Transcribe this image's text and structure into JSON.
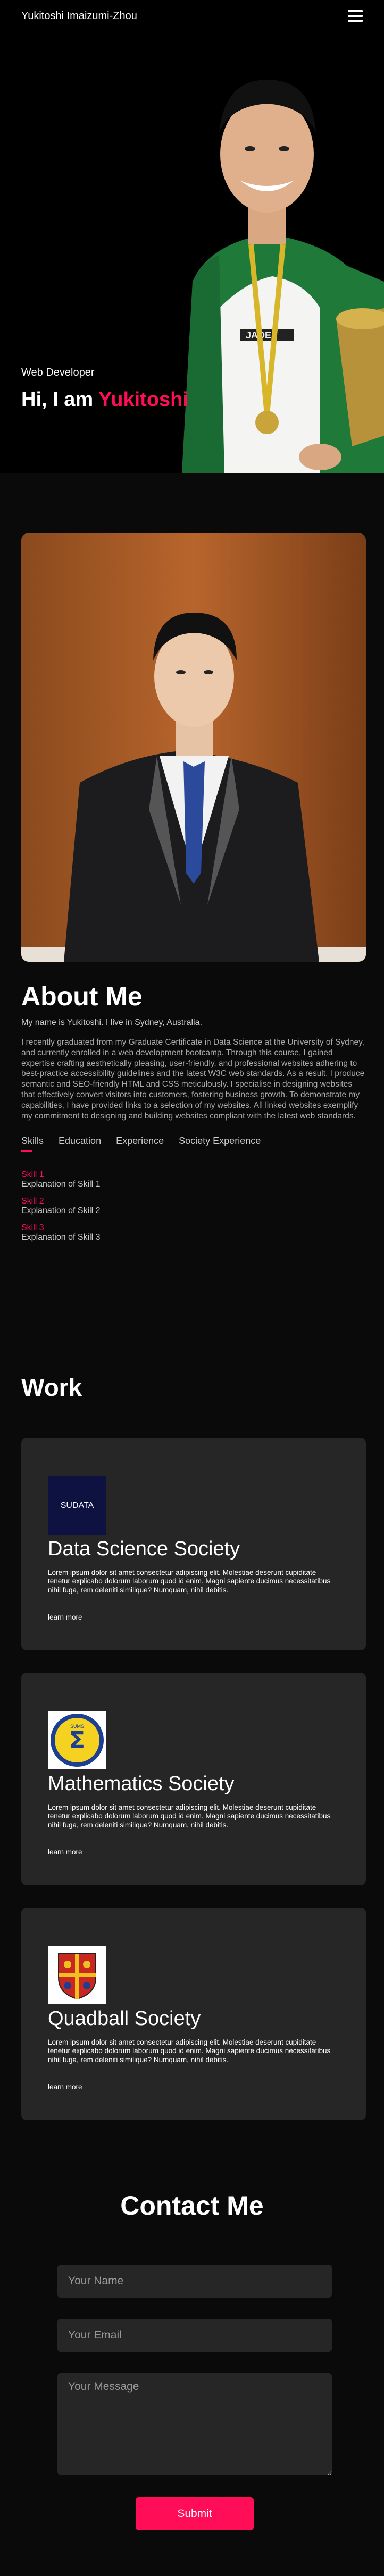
{
  "nav": {
    "brand": "Yukitoshi Imaizumi-Zhou",
    "menu_icon": "hamburger-icon"
  },
  "hero": {
    "subtitle": "Web Developer",
    "title_prefix": "Hi, I am ",
    "title_name": "Yukitoshi"
  },
  "about": {
    "heading": "About Me",
    "intro": "My name is Yukitoshi. I live in Sydney, Australia.",
    "bio": "I recently graduated from my Graduate Certificate in Data Science at the University of Sydney, and currently enrolled in a web development bootcamp. Through this course, I gained expertise crafting aesthetically pleasing, user-friendly, and professional websites adhering to best-practice accessibility guidelines and the latest W3C web standards. As a result, I produce semantic and SEO-friendly HTML and CSS meticulously. I specialise in designing websites that effectively convert visitors into customers, fostering business growth. To demonstrate my capabilities, I have provided links to a selection of my websites. All linked websites exemplify my commitment to designing and building websites compliant with the latest web standards.",
    "tabs": [
      "Skills",
      "Education",
      "Experience",
      "Society Experience"
    ],
    "skills": [
      {
        "name": "Skill 1",
        "desc": "Explanation of Skill 1"
      },
      {
        "name": "Skill 2",
        "desc": "Explanation of Skill 2"
      },
      {
        "name": "Skill 3",
        "desc": "Explanation of Skill 3"
      }
    ]
  },
  "work": {
    "heading": "Work",
    "cards": [
      {
        "logo": "sudata-logo",
        "logo_text": "SUDATA",
        "title": "Data Science Society",
        "text": "Lorem ipsum dolor sit amet consectetur adipiscing elit. Molestiae deserunt cupiditate tenetur explicabo dolorum laborum quod id enim. Magni sapiente ducimus necessitatibus nihil fuga, rem deleniti similique? Numquam, nihil debitis.",
        "link": "learn more"
      },
      {
        "logo": "sums-logo",
        "logo_text": "SUMS",
        "title": "Mathematics Society",
        "text": "Lorem ipsum dolor sit amet consectetur adipiscing elit. Molestiae deserunt cupiditate tenetur explicabo dolorum laborum quod id enim. Magni sapiente ducimus necessitatibus nihil fuga, rem deleniti similique? Numquam, nihil debitis.",
        "link": "learn more"
      },
      {
        "logo": "quadball-crest-logo",
        "logo_text": "",
        "title": "Quadball Society",
        "text": "Lorem ipsum dolor sit amet consectetur adipiscing elit. Molestiae deserunt cupiditate tenetur explicabo dolorum laborum quod id enim. Magni sapiente ducimus necessitatibus nihil fuga, rem deleniti similique? Numquam, nihil debitis.",
        "link": "learn more"
      }
    ]
  },
  "contact": {
    "heading": "Contact Me",
    "name_placeholder": "Your Name",
    "email_placeholder": "Your Email",
    "message_placeholder": "Your Message",
    "submit_label": "Submit"
  },
  "colors": {
    "accent": "#ff0d57",
    "background": "#0a0a0a",
    "card": "#262626"
  }
}
